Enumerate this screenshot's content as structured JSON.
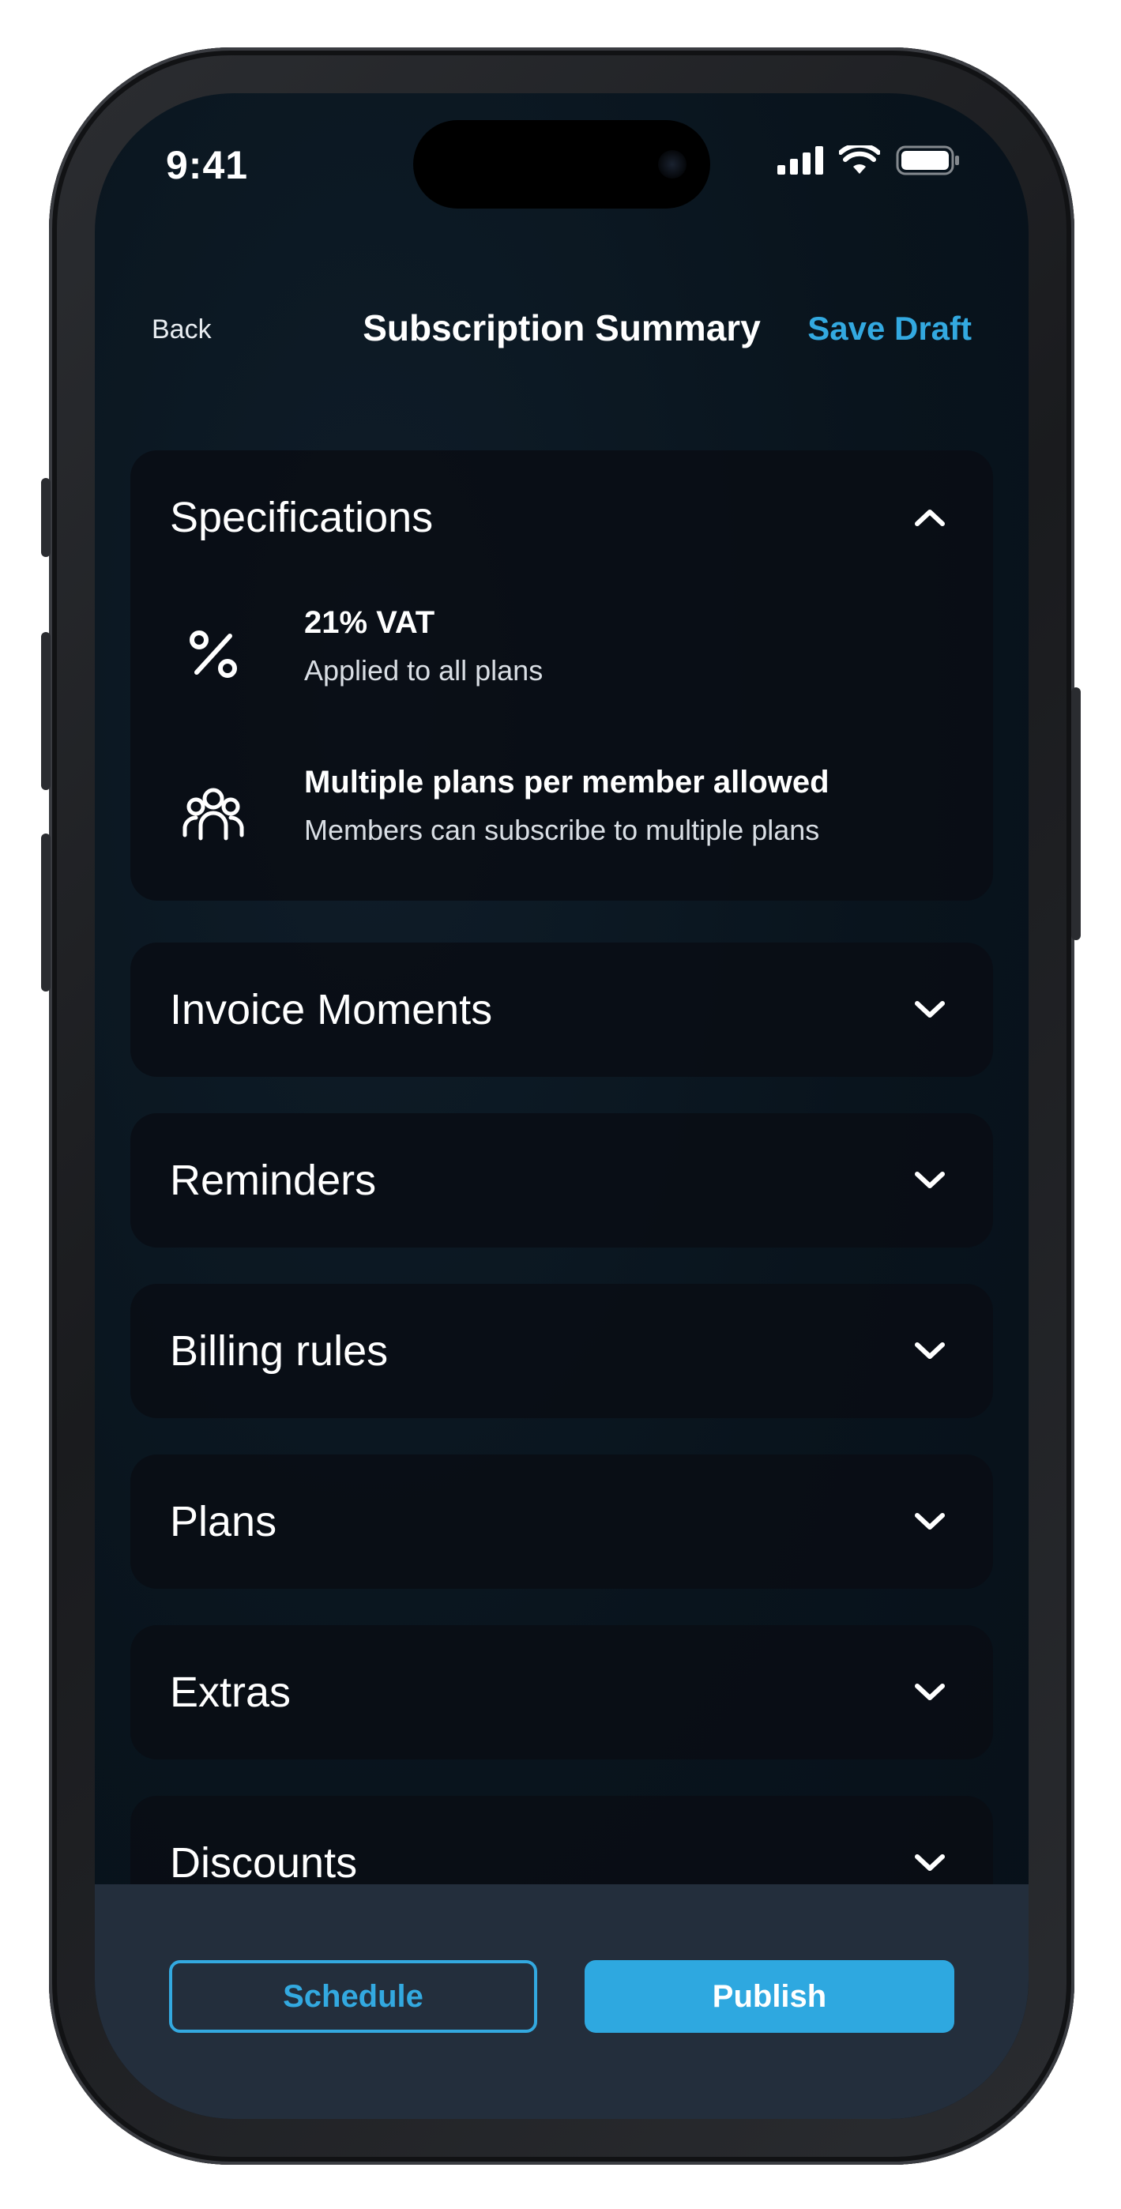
{
  "status_bar": {
    "time": "9:41",
    "icons": [
      "signal-icon",
      "wifi-icon",
      "battery-icon"
    ]
  },
  "nav": {
    "back_label": "Back",
    "title": "Subscription Summary",
    "save_label": "Save Draft"
  },
  "sections": [
    {
      "title": "Specifications",
      "expanded": true,
      "items": [
        {
          "icon": "percent-icon",
          "title": "21% VAT",
          "description": "Applied to all plans"
        },
        {
          "icon": "users-icon",
          "title": "Multiple plans per member allowed",
          "description": "Members can subscribe to multiple plans"
        }
      ]
    },
    {
      "title": "Invoice Moments",
      "expanded": false
    },
    {
      "title": "Reminders",
      "expanded": false
    },
    {
      "title": "Billing rules",
      "expanded": false
    },
    {
      "title": "Plans",
      "expanded": false
    },
    {
      "title": "Extras",
      "expanded": false
    },
    {
      "title": "Discounts",
      "expanded": false
    }
  ],
  "actions": {
    "schedule_label": "Schedule",
    "publish_label": "Publish"
  },
  "colors": {
    "accent": "#2ea8e0",
    "background": "#09141d",
    "card": "#090d14",
    "bottom_bar": "#232e3c"
  }
}
